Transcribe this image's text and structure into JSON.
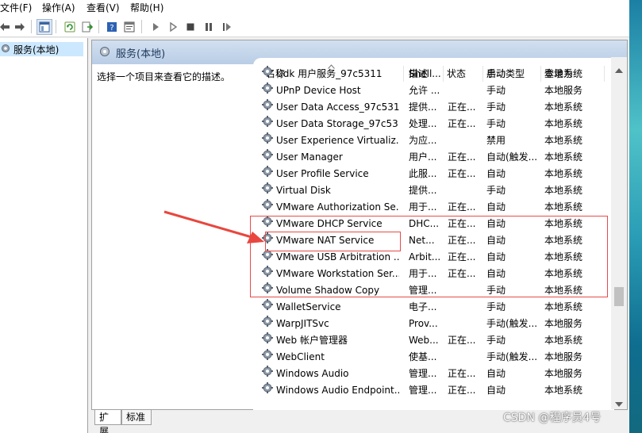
{
  "menu": {
    "file": "文件(F)",
    "action": "操作(A)",
    "view": "查看(V)",
    "help": "帮助(H)"
  },
  "tree": {
    "root_label": "服务(本地)"
  },
  "panel": {
    "header_title": "服务(本地)",
    "description_prompt": "选择一个项目来查看它的描述。"
  },
  "table": {
    "columns": {
      "name": "名称",
      "description": "描述",
      "status": "状态",
      "startup_type": "启动类型",
      "log_on_as": "登录为"
    },
    "rows": [
      {
        "name": "Udk 用户服务_97c5311",
        "description": "Shell...",
        "status": "",
        "startup_type": "手动",
        "log_on_as": "本地系统"
      },
      {
        "name": "UPnP Device Host",
        "description": "允许 ...",
        "status": "",
        "startup_type": "手动",
        "log_on_as": "本地服务"
      },
      {
        "name": "User Data Access_97c5311",
        "description": "提供...",
        "status": "正在...",
        "startup_type": "手动",
        "log_on_as": "本地系统"
      },
      {
        "name": "User Data Storage_97c53...",
        "description": "处理...",
        "status": "正在...",
        "startup_type": "手动",
        "log_on_as": "本地系统"
      },
      {
        "name": "User Experience Virtualiz...",
        "description": "为应...",
        "status": "",
        "startup_type": "禁用",
        "log_on_as": "本地系统"
      },
      {
        "name": "User Manager",
        "description": "用户...",
        "status": "正在...",
        "startup_type": "自动(触发...",
        "log_on_as": "本地系统"
      },
      {
        "name": "User Profile Service",
        "description": "此服...",
        "status": "正在...",
        "startup_type": "自动",
        "log_on_as": "本地系统"
      },
      {
        "name": "Virtual Disk",
        "description": "提供...",
        "status": "",
        "startup_type": "手动",
        "log_on_as": "本地系统"
      },
      {
        "name": "VMware Authorization Se...",
        "description": "用于...",
        "status": "正在...",
        "startup_type": "自动",
        "log_on_as": "本地系统"
      },
      {
        "name": "VMware DHCP Service",
        "description": "DHC...",
        "status": "正在...",
        "startup_type": "自动",
        "log_on_as": "本地系统"
      },
      {
        "name": "VMware NAT Service",
        "description": "Net...",
        "status": "正在...",
        "startup_type": "自动",
        "log_on_as": "本地系统"
      },
      {
        "name": "VMware USB Arbitration ...",
        "description": "Arbit...",
        "status": "正在...",
        "startup_type": "自动",
        "log_on_as": "本地系统"
      },
      {
        "name": "VMware Workstation Ser...",
        "description": "用于...",
        "status": "正在...",
        "startup_type": "自动",
        "log_on_as": "本地系统"
      },
      {
        "name": "Volume Shadow Copy",
        "description": "管理...",
        "status": "",
        "startup_type": "手动",
        "log_on_as": "本地系统"
      },
      {
        "name": "WalletService",
        "description": "电子...",
        "status": "",
        "startup_type": "手动",
        "log_on_as": "本地系统"
      },
      {
        "name": "WarpJITSvc",
        "description": "Prov...",
        "status": "",
        "startup_type": "手动(触发...",
        "log_on_as": "本地服务"
      },
      {
        "name": "Web 帐户管理器",
        "description": "Web...",
        "status": "正在...",
        "startup_type": "手动",
        "log_on_as": "本地系统"
      },
      {
        "name": "WebClient",
        "description": "使基...",
        "status": "",
        "startup_type": "手动(触发...",
        "log_on_as": "本地服务"
      },
      {
        "name": "Windows Audio",
        "description": "管理...",
        "status": "正在...",
        "startup_type": "自动",
        "log_on_as": "本地服务"
      },
      {
        "name": "Windows Audio Endpoint...",
        "description": "管理...",
        "status": "正在...",
        "startup_type": "自动",
        "log_on_as": "本地系统"
      }
    ]
  },
  "tabs": {
    "extended": "扩展",
    "standard": "标准"
  },
  "watermark": "CSDN @程序员4号",
  "colors": {
    "annotation_red": "#e84a4a",
    "selection_blue": "#cce8ff",
    "header_gradient_top": "#d2e0f0",
    "header_gradient_bottom": "#b9cde6"
  }
}
